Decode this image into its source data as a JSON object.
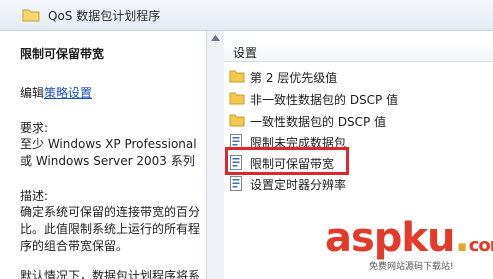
{
  "header": {
    "title": "QoS 数据包计划程序"
  },
  "left_pane": {
    "title": "限制可保留带宽",
    "edit_prefix": "编辑",
    "edit_link": "策略设置",
    "requirements_label": "要求:",
    "requirements_text": "至少 Windows XP Professional 或 Windows Server 2003 系列",
    "description_label": "描述:",
    "description_text": "确定系统可保留的连接带宽的百分比。此值限制系统上运行的所有程序的组合带宽保留。",
    "more_text": "默认情况下，数据包计划程序将系"
  },
  "right_pane": {
    "column_header": "设置",
    "items": [
      {
        "label": "第 2 层优先级值",
        "icon": "folder-icon"
      },
      {
        "label": "非一致性数据包的 DSCP 值",
        "icon": "folder-icon"
      },
      {
        "label": "一致性数据包的 DSCP 值",
        "icon": "folder-icon"
      },
      {
        "label": "限制未完成数据包",
        "icon": "policy-setting-icon"
      },
      {
        "label": "限制可保留带宽",
        "icon": "policy-setting-icon"
      },
      {
        "label": "设置定时器分辨率",
        "icon": "policy-setting-icon"
      }
    ]
  },
  "watermark": {
    "main": "aspku",
    "dot": ".",
    "suffix": "com",
    "sub": "免费网站源码下载站!"
  },
  "colors": {
    "highlight": "#e0262a",
    "link": "#1a4fb8",
    "folder": "#f2c94c"
  }
}
